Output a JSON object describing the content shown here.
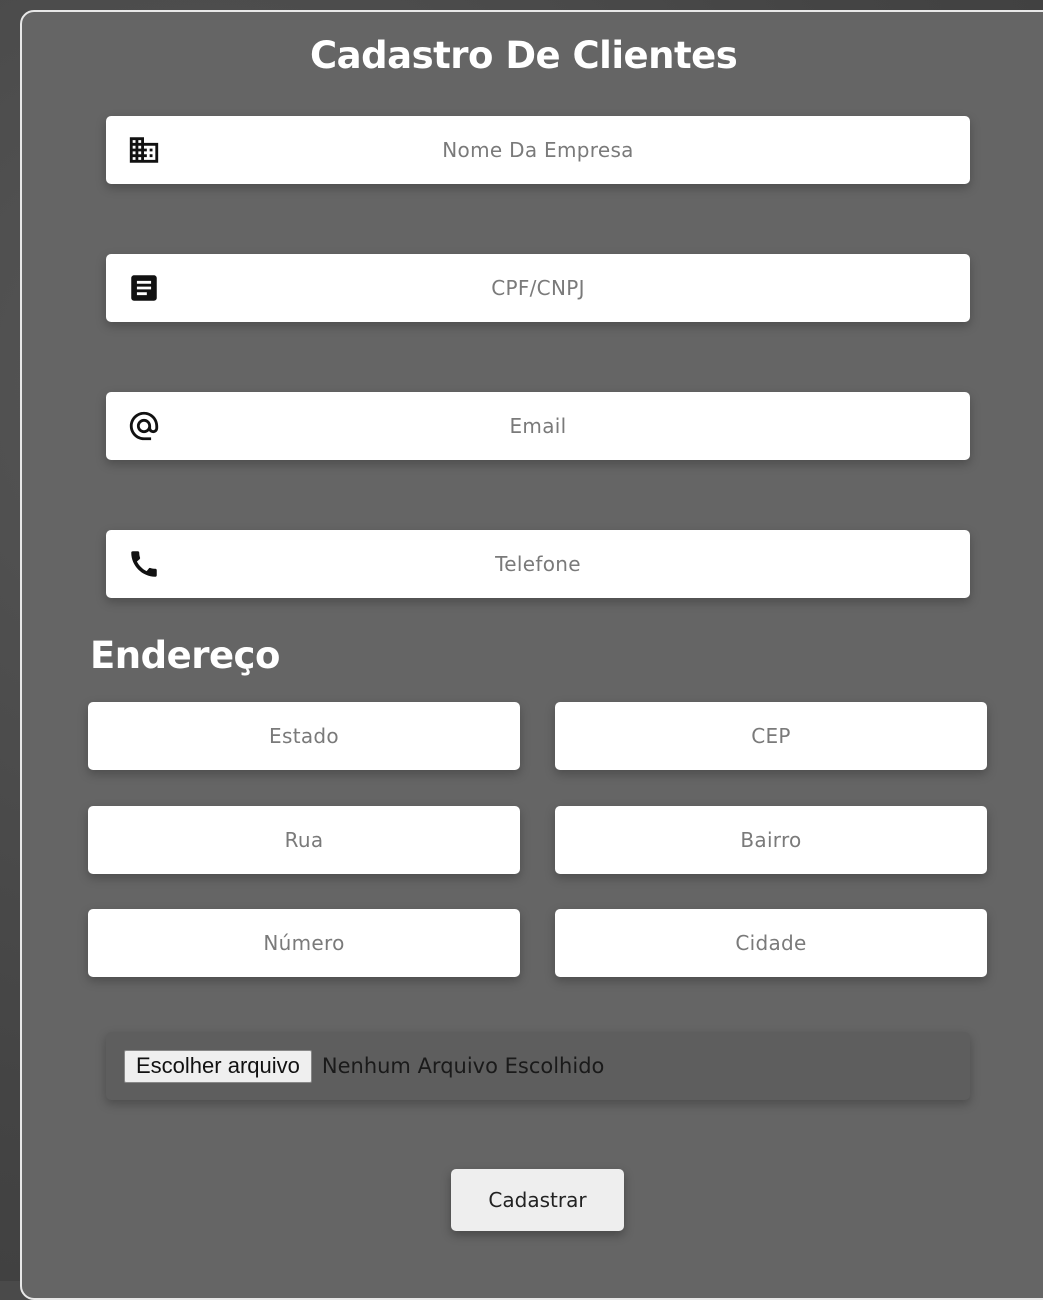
{
  "form": {
    "title": "Cadastro De Clientes",
    "fields": [
      {
        "placeholder": "Nome Da Empresa",
        "icon": "building-icon"
      },
      {
        "placeholder": "CPF/CNPJ",
        "icon": "document-icon"
      },
      {
        "placeholder": "Email",
        "icon": "at-sign-icon"
      },
      {
        "placeholder": "Telefone",
        "icon": "phone-icon"
      }
    ]
  },
  "address": {
    "heading": "Endereço",
    "fields": [
      "Estado",
      "CEP",
      "Rua",
      "Bairro",
      "Número",
      "Cidade"
    ]
  },
  "file_input": {
    "button_label": "Escolher arquivo",
    "status": "Nenhum Arquivo Escolhido"
  },
  "submit": {
    "label": "Cadastrar"
  },
  "colors": {
    "card": "#656565",
    "card_border": "#e8e8e8",
    "field": "#ffffff",
    "placeholder": "#7a7a7a"
  }
}
